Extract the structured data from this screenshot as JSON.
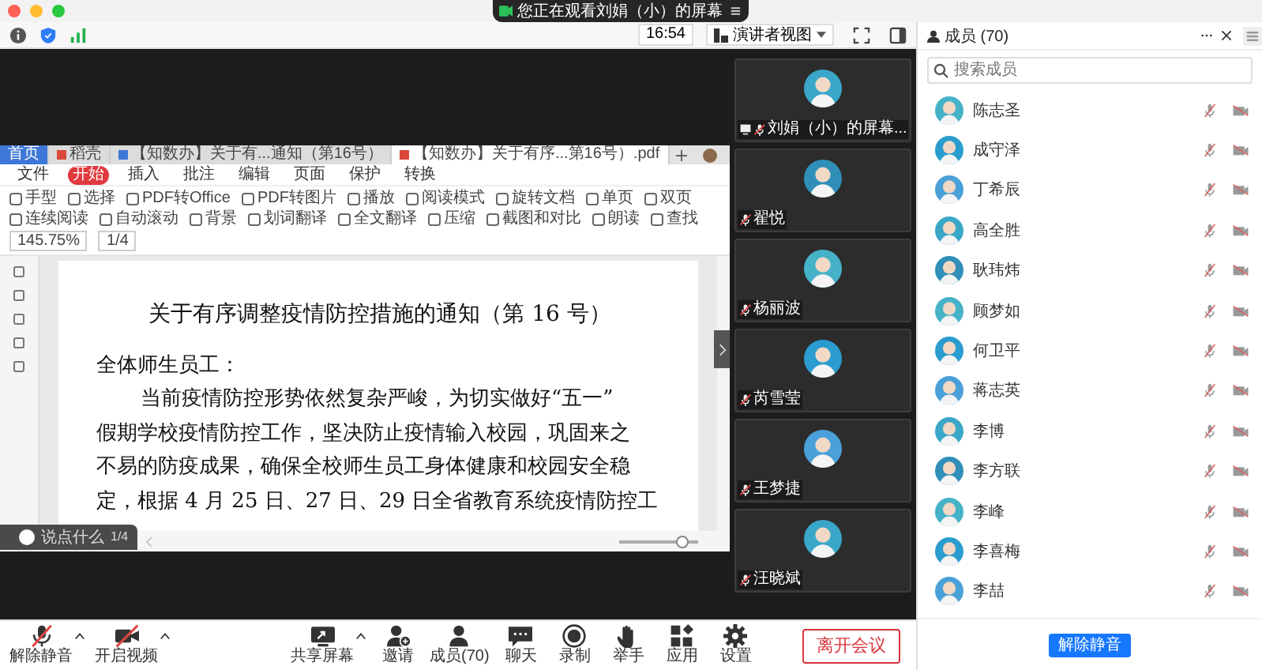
{
  "window": {
    "banner": "您正在观看刘娟（小）的屏幕"
  },
  "top_bar": {
    "time": "16:54",
    "view_button": "演讲者视图"
  },
  "shared_screen": {
    "tabs": [
      {
        "label": "首页",
        "selected": false,
        "kind": "home"
      },
      {
        "label": "稻壳",
        "selected": false,
        "kind": "docer"
      },
      {
        "label": "【知数办】关于有...通知（第16号）",
        "selected": false,
        "kind": "doc"
      },
      {
        "label": "【知数办】关于有序...第16号）.pdf",
        "selected": true,
        "kind": "pdf"
      }
    ],
    "menu": [
      {
        "label": "文件",
        "selected": false
      },
      {
        "label": "开始",
        "selected": true
      },
      {
        "label": "插入",
        "selected": false
      },
      {
        "label": "批注",
        "selected": false
      },
      {
        "label": "编辑",
        "selected": false
      },
      {
        "label": "页面",
        "selected": false
      },
      {
        "label": "保护",
        "selected": false
      },
      {
        "label": "转换",
        "selected": false
      }
    ],
    "toolbar": [
      "手型",
      "选择",
      "PDF转Office",
      "PDF转图片",
      "播放",
      "阅读模式",
      "旋转文档",
      "单页",
      "双页",
      "连续阅读",
      "自动滚动",
      "背景",
      "划词翻译",
      "全文翻译",
      "压缩",
      "截图和对比",
      "朗读",
      "查找"
    ],
    "zoom": "145.75%",
    "page": "1/4",
    "zoom_slider": {
      "level": 0.8
    },
    "document": {
      "title": "关于有序调整疫情防控措施的通知（第 16 号）",
      "greeting": "全体师生员工：",
      "lines": [
        "当前疫情防控形势依然复杂严峻，为切实做好“五一”",
        "假期学校疫情防控工作，坚决防止疫情输入校园，巩固来之",
        "不易的防疫成果，确保全校师生员工身体健康和校园安全稳",
        "定，根据 4 月 25 日、27 日、29 日全省教育系统疫情防控工"
      ]
    },
    "comment": {
      "text": "说点什么",
      "page": "1/4"
    }
  },
  "video_tiles": [
    {
      "name": "刘娟（小）的屏幕...",
      "sharing": true,
      "muted": true
    },
    {
      "name": "翟悦",
      "sharing": false,
      "muted": true
    },
    {
      "name": "杨丽波",
      "sharing": false,
      "muted": true
    },
    {
      "name": "芮雪莹",
      "sharing": false,
      "muted": true
    },
    {
      "name": "王梦捷",
      "sharing": false,
      "muted": true
    },
    {
      "name": "汪晓斌",
      "sharing": false,
      "muted": true
    }
  ],
  "members": {
    "title": "成员 (70)",
    "search": {
      "placeholder": "搜索成员"
    },
    "items": [
      {
        "name": "陈志圣",
        "muted": true,
        "video_off": true
      },
      {
        "name": "成守泽",
        "muted": true,
        "video_off": true
      },
      {
        "name": "丁希辰",
        "muted": true,
        "video_off": true
      },
      {
        "name": "高全胜",
        "muted": true,
        "video_off": true
      },
      {
        "name": "耿玮炜",
        "muted": true,
        "video_off": true
      },
      {
        "name": "顾梦如",
        "muted": true,
        "video_off": true
      },
      {
        "name": "何卫平",
        "muted": true,
        "video_off": true
      },
      {
        "name": "蒋志英",
        "muted": true,
        "video_off": true
      },
      {
        "name": "李博",
        "muted": true,
        "video_off": true
      },
      {
        "name": "李方联",
        "muted": true,
        "video_off": true
      },
      {
        "name": "李峰",
        "muted": true,
        "video_off": true
      },
      {
        "name": "李喜梅",
        "muted": true,
        "video_off": true
      },
      {
        "name": "李喆",
        "muted": true,
        "video_off": true
      }
    ],
    "unmute_button": "解除静音"
  },
  "bottom_toolbar": {
    "items": [
      {
        "label": "解除静音",
        "kind": "mic",
        "caret": true
      },
      {
        "label": "开启视频",
        "kind": "video",
        "caret": true
      },
      {
        "label": "共享屏幕",
        "kind": "share",
        "caret": true
      },
      {
        "label": "邀请",
        "kind": "invite",
        "caret": false
      },
      {
        "label": "成员(70)",
        "kind": "members",
        "caret": false
      },
      {
        "label": "聊天",
        "kind": "chat",
        "caret": false
      },
      {
        "label": "录制",
        "kind": "record",
        "caret": false
      },
      {
        "label": "举手",
        "kind": "hand",
        "caret": false
      },
      {
        "label": "应用",
        "kind": "apps",
        "caret": false
      },
      {
        "label": "设置",
        "kind": "settings",
        "caret": false
      }
    ],
    "leave_button": "离开会议"
  }
}
